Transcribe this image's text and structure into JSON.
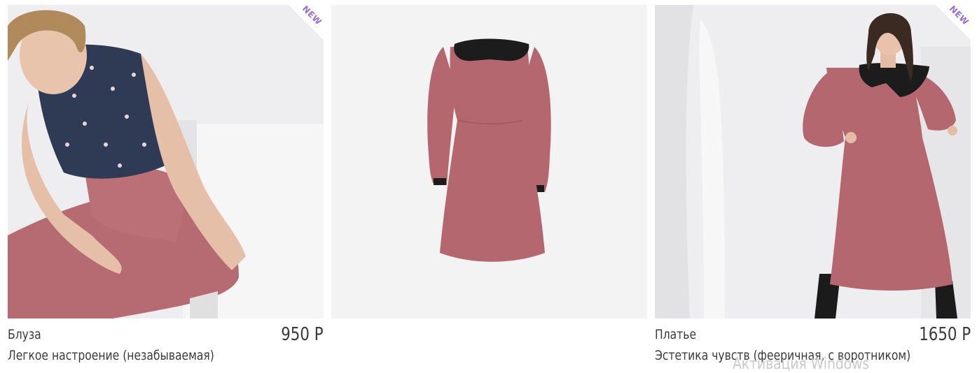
{
  "products": [
    {
      "category": "Блуза",
      "name": "Легкое настроение (незабываемая)",
      "price": "950 Р",
      "badge": "NEW",
      "image_icon": "model-photo"
    },
    {
      "category": "",
      "name": "",
      "price": "",
      "badge": "",
      "image_icon": "dress-photo"
    },
    {
      "category": "Платье",
      "name": "Эстетика чувств (фееричная, с воротником)",
      "price": "1650 Р",
      "badge": "NEW",
      "image_icon": "model-photo"
    }
  ],
  "os_watermark": "Активация Windows",
  "colors": {
    "badge_text": "#9a6cd6",
    "dress_pink": "#b5676f",
    "collar_black": "#1c1c1c",
    "blouse_navy": "#2f3a55"
  }
}
